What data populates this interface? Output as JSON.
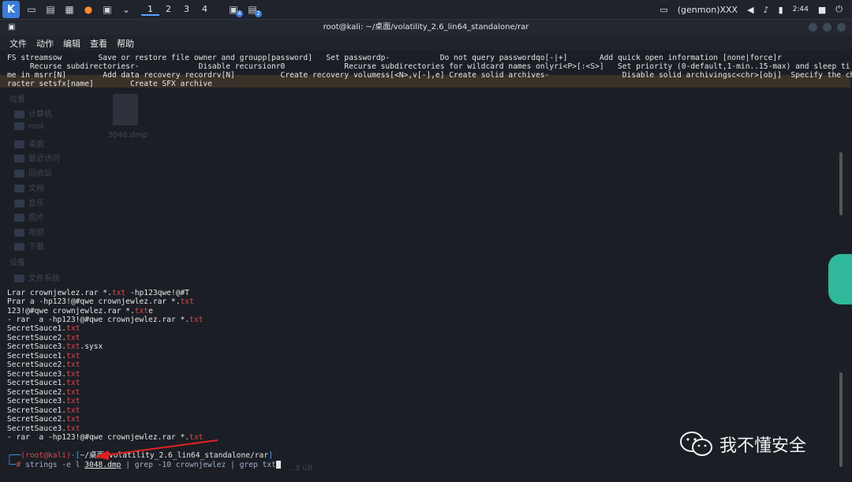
{
  "taskbar": {
    "workspaces": [
      "1",
      "2",
      "3",
      "4"
    ],
    "badges": [
      "4",
      "2"
    ],
    "tray_label": "(genmon)XXX",
    "time": "2:44"
  },
  "window": {
    "title": "root@kali: ~/桌面/volatility_2.6_lin64_standalone/rar"
  },
  "menu": [
    "文件",
    "动作",
    "编辑",
    "查看",
    "帮助"
  ],
  "terminal": {
    "help_lines": [
      "FS streamsow        Save or restore file owner and groupp[password]   Set passwordp-           Do not query passwordqo[-|+]       Add quick open information [none|force]r",
      "     Recurse subdirectoriesr-             Disable recursionr0             Recurse subdirectories for wildcard names onlyri<P>[:<S>]   Set priority (0-default,1-min..15-max) and sleep ti",
      "me in msrr[N]        Add data recovery recordrv[N]          Create recovery volumess[<N>,v[-],e] Create solid archives-                Disable solid archivingsc<chr>[obj]  Specify the cha",
      "racter setsfx[name]        Create SFX archive"
    ],
    "cmd_lines": [
      {
        "pre": "Lrar crownjewlez.rar *.",
        "ext": "txt",
        "post": " -hp123qwe!@#T"
      },
      {
        "pre": "Prar a -hp123!@#qwe crownjewlez.rar *.",
        "ext": "txt",
        "post": ""
      },
      {
        "pre": "123!@#qwe crownjewlez.rar *.",
        "ext": "txt",
        "post": "e"
      },
      {
        "pre": "- rar  a -hp123!@#qwe crownjewlez.rar *.",
        "ext": "txt",
        "post": ""
      }
    ],
    "sauce_lines": [
      {
        "pre": "SecretSauce1.",
        "ext": "txt",
        "post": ""
      },
      {
        "pre": "SecretSauce2.",
        "ext": "txt",
        "post": ""
      },
      {
        "pre": "SecretSauce3.",
        "ext": "txt",
        "post": ".sysx"
      },
      {
        "pre": "SecretSauce1.",
        "ext": "txt",
        "post": ""
      },
      {
        "pre": "SecretSauce2.",
        "ext": "txt",
        "post": ""
      },
      {
        "pre": "SecretSauce3.",
        "ext": "txt",
        "post": ""
      },
      {
        "pre": "SecretSauce1.",
        "ext": "txt",
        "post": ""
      },
      {
        "pre": "SecretSauce2.",
        "ext": "txt",
        "post": ""
      },
      {
        "pre": "SecretSauce3.",
        "ext": "txt",
        "post": ""
      },
      {
        "pre": "SecretSauce1.",
        "ext": "txt",
        "post": ""
      },
      {
        "pre": "SecretSauce2.",
        "ext": "txt",
        "post": ""
      },
      {
        "pre": "SecretSauce3.",
        "ext": "txt",
        "post": ""
      }
    ],
    "last_cmd": {
      "pre": "- rar  a -hp123!@#qwe crownjewlez.rar *.",
      "ext": "txt",
      "post": ""
    },
    "prompt_user": "(root@kali)",
    "prompt_path": "~/桌面/volatility_2.6_lin64_standalone/rar",
    "prompt_cmd": {
      "a": "strings -e l ",
      "file": "3048.dmp",
      "b": " | grep -10 crownjewlez | grep txt"
    }
  },
  "background": {
    "places_title": "位置",
    "places": [
      "计算机",
      "root",
      "桌面",
      "最近访问",
      "回收站",
      "文档",
      "音乐",
      "图片",
      "视频",
      "下载"
    ],
    "devices_title": "设备",
    "devices": [
      "文件系统"
    ],
    "file_icon_label": "3048.dmp",
    "disk_label": "...8 GB"
  },
  "watermark": {
    "text": "我不懂安全"
  }
}
